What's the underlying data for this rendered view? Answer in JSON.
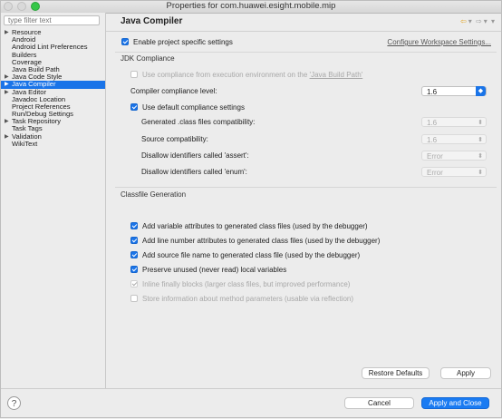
{
  "window": {
    "title": "Properties for com.huawei.esight.mobile.mip"
  },
  "sidebar": {
    "filter_placeholder": "type filter text",
    "items": [
      {
        "label": "Resource",
        "expandable": true,
        "selected": false
      },
      {
        "label": "Android",
        "expandable": false,
        "selected": false
      },
      {
        "label": "Android Lint Preferences",
        "expandable": false,
        "selected": false
      },
      {
        "label": "Builders",
        "expandable": false,
        "selected": false
      },
      {
        "label": "Coverage",
        "expandable": false,
        "selected": false
      },
      {
        "label": "Java Build Path",
        "expandable": false,
        "selected": false
      },
      {
        "label": "Java Code Style",
        "expandable": true,
        "selected": false
      },
      {
        "label": "Java Compiler",
        "expandable": true,
        "selected": true
      },
      {
        "label": "Java Editor",
        "expandable": true,
        "selected": false
      },
      {
        "label": "Javadoc Location",
        "expandable": false,
        "selected": false
      },
      {
        "label": "Project References",
        "expandable": false,
        "selected": false
      },
      {
        "label": "Run/Debug Settings",
        "expandable": false,
        "selected": false
      },
      {
        "label": "Task Repository",
        "expandable": true,
        "selected": false
      },
      {
        "label": "Task Tags",
        "expandable": false,
        "selected": false
      },
      {
        "label": "Validation",
        "expandable": true,
        "selected": false
      },
      {
        "label": "WikiText",
        "expandable": false,
        "selected": false
      }
    ]
  },
  "main": {
    "title": "Java Compiler",
    "nav": {
      "back": "⇦",
      "back_menu": "▾",
      "forward": "⇨",
      "forward_menu": "▾",
      "view_menu": "▾"
    },
    "enable_specific": "Enable project specific settings",
    "configure_link": "Configure Workspace Settings...",
    "jdk": {
      "section": "JDK Compliance",
      "use_env_prefix": "Use compliance from execution environment on the ",
      "use_env_link": "'Java Build Path'",
      "compliance_label": "Compiler compliance level:",
      "compliance_value": "1.6",
      "use_default": "Use default compliance settings",
      "rows": [
        {
          "label": "Generated .class files compatibility:",
          "value": "1.6"
        },
        {
          "label": "Source compatibility:",
          "value": "1.6"
        },
        {
          "label": "Disallow identifiers called 'assert':",
          "value": "Error"
        },
        {
          "label": "Disallow identifiers called 'enum':",
          "value": "Error"
        }
      ]
    },
    "classfile": {
      "section": "Classfile Generation",
      "options": [
        {
          "label": "Add variable attributes to generated class files (used by the debugger)",
          "state": "on"
        },
        {
          "label": "Add line number attributes to generated class files (used by the debugger)",
          "state": "on"
        },
        {
          "label": "Add source file name to generated class file (used by the debugger)",
          "state": "on"
        },
        {
          "label": "Preserve unused (never read) local variables",
          "state": "on"
        },
        {
          "label": "Inline finally blocks (larger class files, but improved performance)",
          "state": "disabled-on"
        },
        {
          "label": "Store information about method parameters (usable via reflection)",
          "state": "disabled-off"
        }
      ]
    },
    "restore_defaults": "Restore Defaults",
    "apply": "Apply"
  },
  "footer": {
    "help": "?",
    "cancel": "Cancel",
    "apply_close": "Apply and Close"
  },
  "colors": {
    "accent": "#1a74e8",
    "primary_button": "#1a7bf2",
    "nav_back": "#e3a21a"
  }
}
